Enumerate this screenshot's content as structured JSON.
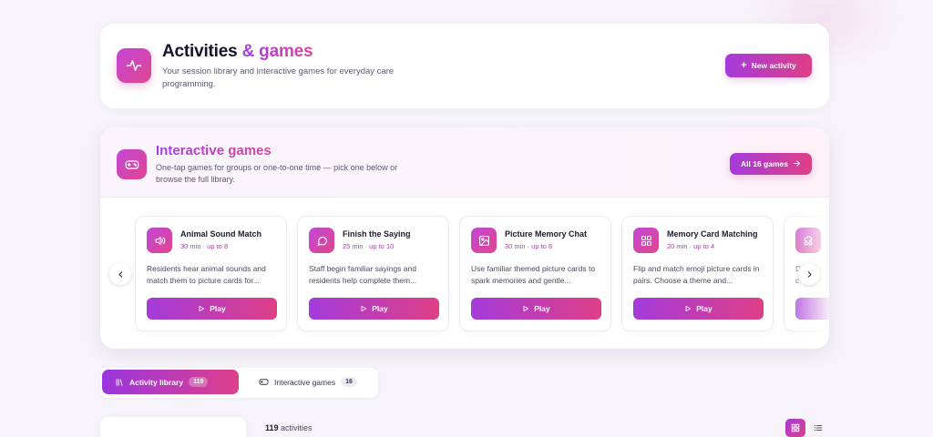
{
  "header": {
    "title_part1": "Activities",
    "title_part2": "& games",
    "subtitle": "Your session library and interactive games for everyday care programming.",
    "new_activity_label": "New activity",
    "icon": "activity-pulse-icon"
  },
  "games_section": {
    "title": "Interactive games",
    "subtitle": "One-tap games for groups or one-to-one time — pick one below or browse the full library.",
    "all_games_label": "All 16 games",
    "icon": "gamepad-icon",
    "games": [
      {
        "title": "Animal Sound Match",
        "meta": "30 min · up to 8",
        "description": "Residents hear animal sounds and match them to picture cards for...",
        "play_label": "Play",
        "icon": "speaker-icon"
      },
      {
        "title": "Finish the Saying",
        "meta": "25 min · up to 10",
        "description": "Staff begin familiar sayings and residents help complete them...",
        "play_label": "Play",
        "icon": "chat-bubble-icon"
      },
      {
        "title": "Picture Memory Chat",
        "meta": "30 min · up to 6",
        "description": "Use familiar themed picture cards to spark memories and gentle...",
        "play_label": "Play",
        "icon": "image-icon"
      },
      {
        "title": "Memory Card Matching",
        "meta": "20 min · up to 4",
        "description": "Flip and match emoji picture cards in pairs. Choose a theme and...",
        "play_label": "Play",
        "icon": "grid-icon"
      }
    ],
    "partial_game": {
      "desc_line1": "D",
      "desc_line2": "c",
      "icon": "puzzle-icon"
    }
  },
  "tabs": [
    {
      "label": "Activity library",
      "count": "119",
      "icon": "library-icon"
    },
    {
      "label": "Interactive games",
      "count": "16",
      "icon": "gamepad-icon"
    }
  ],
  "results": {
    "count": "119",
    "label": "activities"
  },
  "colors": {
    "accent_start": "#a43bdc",
    "accent_end": "#df3f86",
    "meta_text": "#a2449f"
  }
}
